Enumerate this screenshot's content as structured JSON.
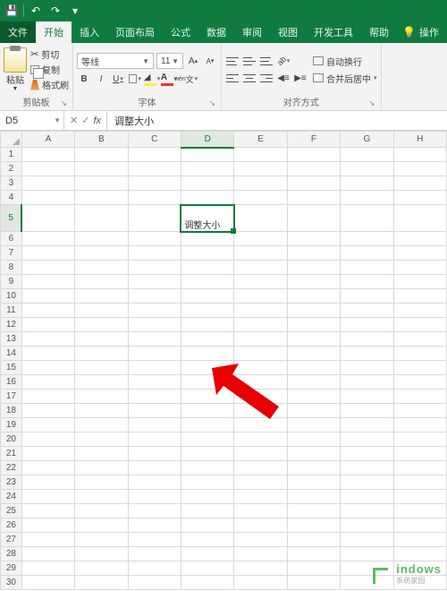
{
  "qat": {
    "save": "💾",
    "undo": "↶",
    "redo": "↷"
  },
  "tabs": {
    "file": "文件",
    "home": "开始",
    "insert": "插入",
    "layout": "页面布局",
    "formulas": "公式",
    "data": "数据",
    "review": "审阅",
    "view": "视图",
    "dev": "开发工具",
    "help": "帮助",
    "tell": "操作"
  },
  "clipboard": {
    "paste": "粘贴",
    "cut": "剪切",
    "copy": "复制",
    "painter": "格式刷",
    "label": "剪贴板"
  },
  "font": {
    "name": "等线",
    "size": "11",
    "grow": "A",
    "shrink": "A",
    "bold": "B",
    "italic": "I",
    "underline": "U",
    "label": "字体"
  },
  "alignment": {
    "wrap": "自动换行",
    "merge": "合并后居中",
    "label": "对齐方式"
  },
  "namebox": "D5",
  "formula": "调整大小",
  "columns": [
    "A",
    "B",
    "C",
    "D",
    "E",
    "F",
    "G",
    "H"
  ],
  "rows": [
    "1",
    "2",
    "3",
    "4",
    "5",
    "6",
    "7",
    "8",
    "9",
    "10",
    "11",
    "12",
    "13",
    "14",
    "15",
    "16",
    "17",
    "18",
    "19",
    "20",
    "21",
    "22",
    "23",
    "24",
    "25",
    "26",
    "27",
    "28",
    "29",
    "30"
  ],
  "active_cell_value": "调整大小",
  "watermark": {
    "brand": "indows",
    "sub": "系统家园"
  }
}
